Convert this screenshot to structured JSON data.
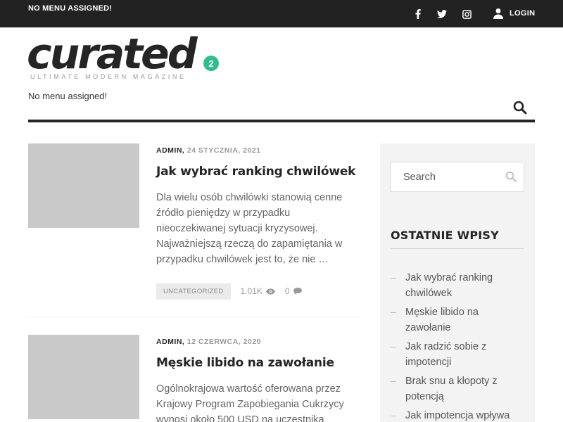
{
  "topbar": {
    "menu_text": "NO MENU ASSIGNED!",
    "login_label": "LOGIN",
    "social_icons": [
      "facebook-icon",
      "twitter-icon",
      "instagram-icon"
    ]
  },
  "logo": {
    "wordmark": "curated",
    "badge": "2",
    "tagline": "ULTIMATE MODERN MAGAZINE",
    "badge_color": "#2fbd8a"
  },
  "main_menu": {
    "text": "No menu assigned!"
  },
  "posts": [
    {
      "author": "ADMIN,",
      "date": "24 STYCZNIA, 2021",
      "title": "Jak wybrać ranking chwilówek",
      "excerpt": "Dla wielu osób chwilówki stanowią cenne źródło pieniędzy w przypadku nieoczekiwanej sytuacji kryzysowej. Najważniejszą rzeczą do zapamiętania w przypadku chwilówek jest to, że nie …",
      "category": "UNCATEGORIZED",
      "views": "1.01K",
      "comments": "0"
    },
    {
      "author": "ADMIN,",
      "date": "12 CZERWCA, 2020",
      "title": "Męskie libido na zawołanie",
      "excerpt": "Ogólnokrajowa wartość oferowana przez Krajowy Program Zapobiegania Cukrzycy wynosi około 500 USD na uczestnika"
    }
  ],
  "sidebar": {
    "search_placeholder": "Search",
    "recent_title": "OSTATNIE WPISY",
    "recent_posts": [
      "Jak wybrać ranking chwilówek",
      "Męskie libido na zawołanie",
      "Jak radzić sobie z impotencji",
      "Brak snu a kłopoty z potencją",
      "Jak impotencja wpływa"
    ]
  },
  "colors": {
    "topbar_bg": "#222222",
    "accent": "#2fbd8a",
    "sidebar_bg": "#f3f3f3"
  }
}
